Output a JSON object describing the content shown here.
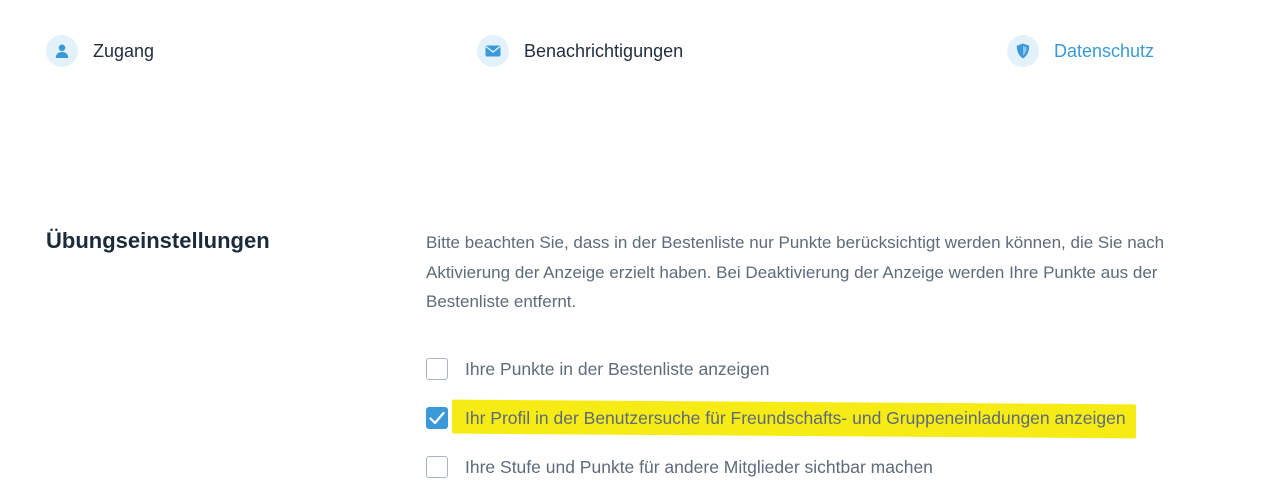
{
  "nav": {
    "items": [
      {
        "label": "Zugang",
        "icon": "user-icon",
        "active": false
      },
      {
        "label": "Benachrichtigungen",
        "icon": "envelope-icon",
        "active": false
      },
      {
        "label": "Datenschutz",
        "icon": "shield-icon",
        "active": true
      }
    ]
  },
  "colors": {
    "accent": "#3a9ad9",
    "icon_bg": "#e3f1fb",
    "highlight": "#f7eb15",
    "text": "#5d6b7a",
    "heading": "#1b2b3a"
  },
  "section": {
    "title": "Übungseinstellungen",
    "description": "Bitte beachten Sie, dass in der Bestenliste nur Punkte berücksichtigt werden können, die Sie nach Aktivierung der Anzeige erzielt haben. Bei Deaktivierung der Anzeige werden Ihre Punkte aus der Bestenliste entfernt.",
    "options": [
      {
        "label": "Ihre Punkte in der Bestenliste anzeigen",
        "checked": false
      },
      {
        "label": "Ihr Profil in der Benutzersuche für Freundschafts- und Gruppeneinladungen anzeigen",
        "checked": true
      },
      {
        "label": "Ihre Stufe und Punkte für andere Mitglieder sichtbar machen",
        "checked": false
      }
    ]
  }
}
